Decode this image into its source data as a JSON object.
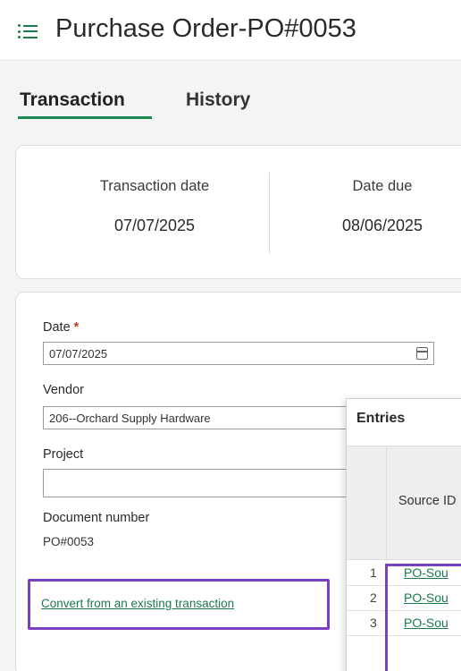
{
  "header": {
    "title": "Purchase Order-PO#0053",
    "menu_icon": "menu-icon"
  },
  "tabs": [
    {
      "label": "Transaction",
      "active": true
    },
    {
      "label": "History",
      "active": false
    }
  ],
  "summary": {
    "transaction_date_label": "Transaction date",
    "transaction_date_value": "07/07/2025",
    "date_due_label": "Date due",
    "date_due_value": "08/06/2025"
  },
  "form": {
    "date_label": "Date",
    "required_mark": "*",
    "date_value": "07/07/2025",
    "vendor_label": "Vendor",
    "vendor_value": "206--Orchard Supply Hardware",
    "project_label": "Project",
    "project_value": "",
    "document_number_label": "Document number",
    "document_number_value": "PO#0053",
    "convert_link": "Convert from an existing transaction"
  },
  "entries": {
    "title": "Entries",
    "column_header": "Source ID",
    "rows": [
      {
        "num": "1",
        "source_id": "PO-Sou"
      },
      {
        "num": "2",
        "source_id": "PO-Sou"
      },
      {
        "num": "3",
        "source_id": "PO-Sou"
      }
    ]
  },
  "colors": {
    "accent": "#1f8a4f",
    "highlight": "#7b3fc4",
    "required": "#c0392b"
  }
}
